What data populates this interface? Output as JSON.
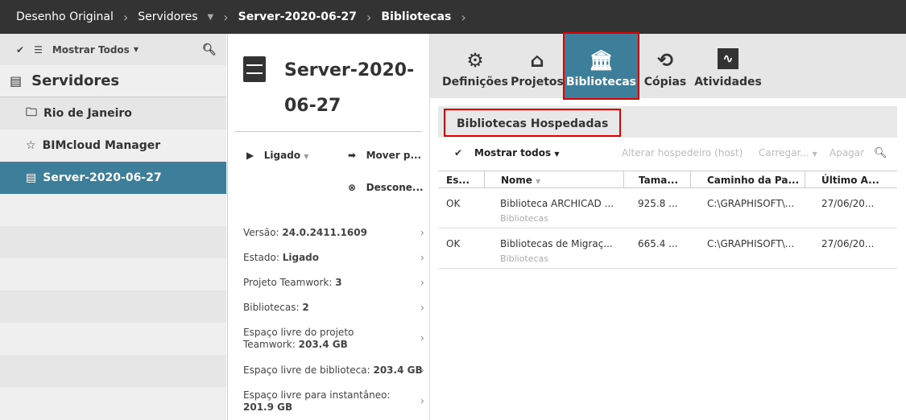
{
  "breadcrumb": [
    "Desenho Original",
    "Servidores",
    "Server-2020-06-27",
    "Bibliotecas"
  ],
  "sidebar": {
    "filter_label": "Mostrar Todos",
    "header": "Servidores",
    "items": [
      {
        "label": "Rio de Janeiro",
        "icon": "folder-icon"
      },
      {
        "label": "BIMcloud Manager",
        "icon": "manager-icon"
      },
      {
        "label": "Server-2020-06-27",
        "icon": "server-icon",
        "selected": true
      }
    ]
  },
  "detail": {
    "title_line1": "Server-2020-",
    "title_line2": "06-27",
    "actions": {
      "state": "Ligado",
      "move": "Mover p...",
      "disconnect": "Descone..."
    },
    "info": [
      {
        "label": "Versão: ",
        "value": "24.0.2411.1609"
      },
      {
        "label": "Estado: ",
        "value": "Ligado"
      },
      {
        "label": "Projeto Teamwork: ",
        "value": "3"
      },
      {
        "label": "Bibliotecas: ",
        "value": "2"
      },
      {
        "label": "Espaço livre do projeto Teamwork: ",
        "value": "203.4 GB"
      },
      {
        "label": "Espaço livre de biblioteca: ",
        "value": "203.4 GB"
      },
      {
        "label": "Espaço livre para instantâneo: ",
        "value": "201.9 GB"
      }
    ]
  },
  "tabs": [
    {
      "label": "Definições",
      "icon": "gear-icon"
    },
    {
      "label": "Projetos",
      "icon": "projects-icon"
    },
    {
      "label": "Bibliotecas",
      "icon": "library-icon",
      "active": true
    },
    {
      "label": "Cópias",
      "icon": "backup-icon"
    },
    {
      "label": "Atividades",
      "icon": "activity-icon"
    }
  ],
  "section_title": "Bibliotecas Hospedadas",
  "toolbar": {
    "show_all": "Mostrar todos",
    "change_host": "Alterar hospedeiro (host)",
    "upload": "Carregar...",
    "delete": "Apagar"
  },
  "table": {
    "columns": [
      "Es...",
      "Nome",
      "Tama...",
      "Caminho da Pa...",
      "Último A..."
    ],
    "rows": [
      {
        "status": "OK",
        "name": "Biblioteca ARCHICAD ...",
        "type": "Bibliotecas",
        "size": "925.8 ...",
        "path": "C:\\GRAPHISOFT\\...",
        "last": "27/06/20..."
      },
      {
        "status": "OK",
        "name": "Bibliotecas de Migraç...",
        "type": "Bibliotecas",
        "size": "665.4 ...",
        "path": "C:\\GRAPHISOFT\\...",
        "last": "27/06/20..."
      }
    ]
  },
  "colors": {
    "accent": "#3d7f9a",
    "topbar": "#333333",
    "highlight": "#e00000"
  }
}
